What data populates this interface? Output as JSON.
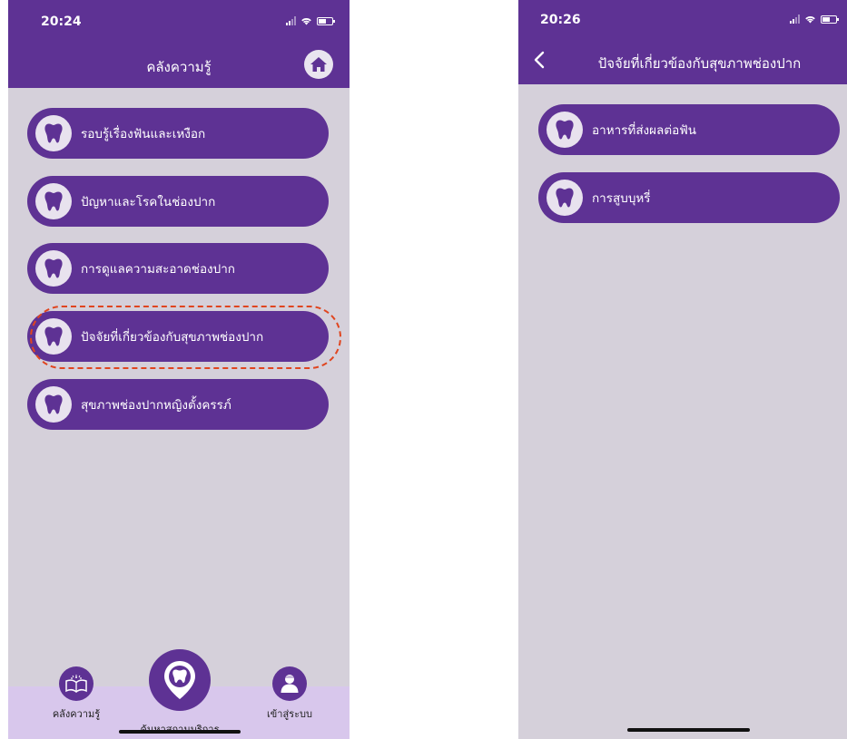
{
  "left_screen": {
    "status_time": "20:24",
    "nav_title": "คลังความรู้",
    "menu_items": [
      {
        "label": "รอบรู้เรื่องฟันและเหงือก"
      },
      {
        "label": "ปัญหาและโรคในช่องปาก"
      },
      {
        "label": "การดูแลความสะอาดช่องปาก"
      },
      {
        "label": "ปัจจัยที่เกี่ยวข้องกับสุขภาพช่องปาก",
        "highlighted": true
      },
      {
        "label": "สุขภาพช่องปากหญิงตั้งครรภ์"
      }
    ],
    "tabs": {
      "knowledge": "คลังความรู้",
      "find_service": "ค้นหาสถานบริการ",
      "login": "เข้าสู่ระบบ"
    }
  },
  "right_screen": {
    "status_time": "20:26",
    "nav_title": "ปัจจัยที่เกี่ยวข้องกับสุขภาพช่องปาก",
    "menu_items": [
      {
        "label": "อาหารที่ส่งผลต่อฟัน"
      },
      {
        "label": "การสูบบุหรี่"
      }
    ]
  },
  "colors": {
    "primary": "#5e3294",
    "background": "#d5d0da",
    "tab_bar": "#d8c7ec",
    "highlight": "#e0451f"
  }
}
